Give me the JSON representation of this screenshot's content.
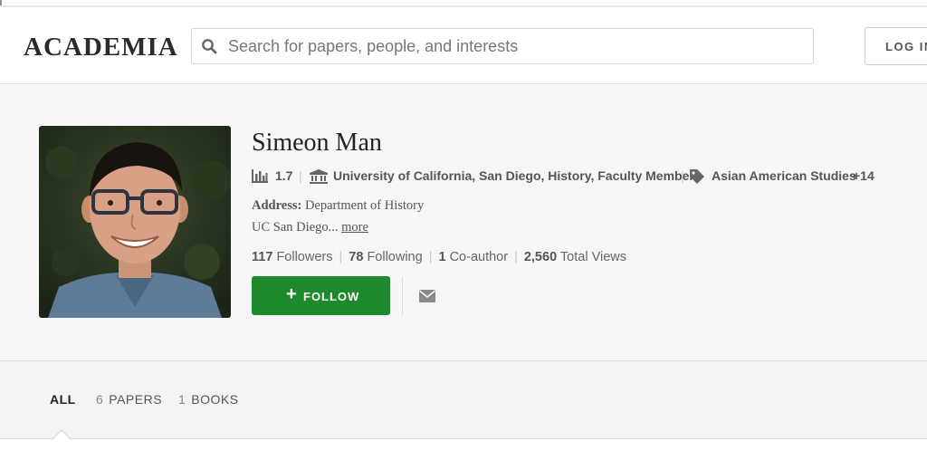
{
  "header": {
    "logo": "ACADEMIA",
    "search_placeholder": "Search for papers, people, and interests",
    "login_label": "LOG IN"
  },
  "profile": {
    "name": "Simeon Man",
    "impact_score": "1.7",
    "affiliation": "University of California, San Diego, History, Faculty Member",
    "research_interest": "Asian American Studies",
    "more_interests": "+14",
    "address_label": "Address:",
    "address_value": "Department of History",
    "address_line2": "UC San Diego...",
    "more_link": "more",
    "stats": {
      "followers_count": "117",
      "followers_label": "Followers",
      "following_count": "78",
      "following_label": "Following",
      "coauthors_count": "1",
      "coauthors_label": "Co-author",
      "views_count": "2,560",
      "views_label": "Total Views"
    },
    "follow_label": "FOLLOW"
  },
  "tabs": [
    {
      "count": "",
      "label": "ALL",
      "active": true
    },
    {
      "count": "6",
      "label": "PAPERS",
      "active": false
    },
    {
      "count": "1",
      "label": "BOOKS",
      "active": false
    }
  ],
  "icons": {
    "search": "search-icon",
    "analytics": "bar-chart-icon",
    "institution": "institution-icon",
    "tag": "tag-icon",
    "mail": "mail-icon",
    "follow": "plus-icon"
  },
  "colors": {
    "follow_button": "#1e8a2d",
    "profile_background": "#f6f6f6",
    "tabs_background": "#f3f3f3"
  }
}
